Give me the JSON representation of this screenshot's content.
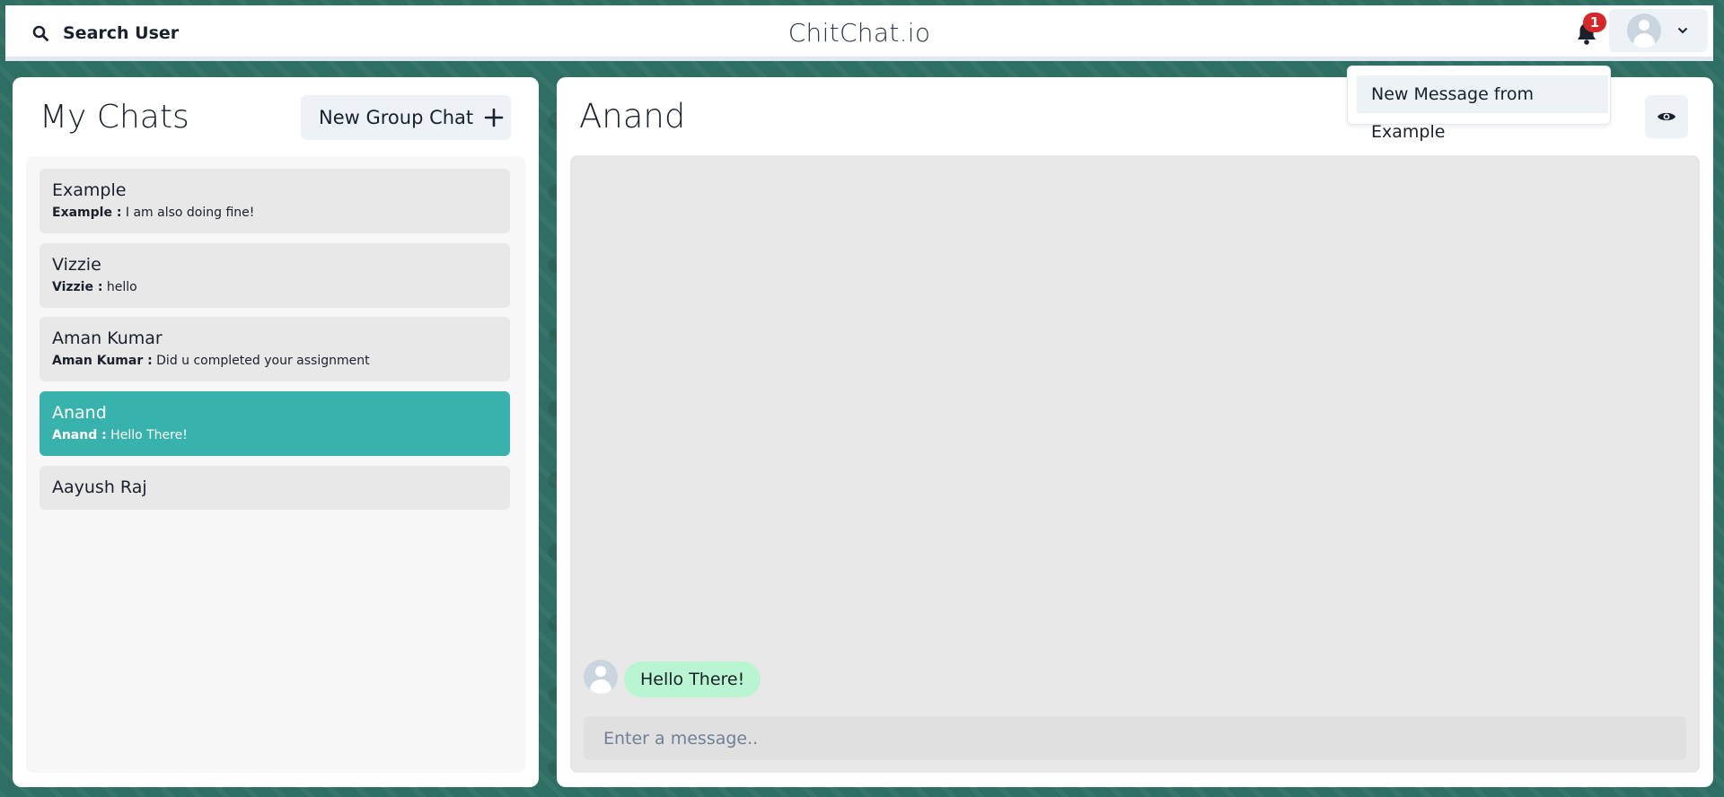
{
  "header": {
    "search_label": "Search User",
    "brand": "ChitChat.io",
    "notification_count": "1"
  },
  "notifications": {
    "items": [
      "New Message from Example"
    ]
  },
  "sidebar": {
    "title": "My Chats",
    "new_group_label": "New Group Chat",
    "chats": [
      {
        "name": "Example",
        "sender": "Example :",
        "message": "I am also doing fine!",
        "active": false
      },
      {
        "name": "Vizzie",
        "sender": "Vizzie :",
        "message": "hello",
        "active": false
      },
      {
        "name": "Aman Kumar",
        "sender": "Aman Kumar :",
        "message": "Did u completed your assignment",
        "active": false
      },
      {
        "name": "Anand",
        "sender": "Anand :",
        "message": "Hello There!",
        "active": true
      },
      {
        "name": "Aayush Raj",
        "sender": "",
        "message": "",
        "active": false
      }
    ]
  },
  "chat": {
    "title": "Anand",
    "messages": [
      {
        "text": "Hello There!"
      }
    ],
    "input_placeholder": "Enter a message.."
  },
  "colors": {
    "active_chat": "#38b2ac",
    "message_bubble": "#b9f5d0",
    "badge": "#d62828",
    "background_pattern": "#2f6f63"
  },
  "icons": {
    "search": "search-icon",
    "bell": "bell-icon",
    "avatar": "avatar-icon",
    "chevron": "chevron-down-icon",
    "plus": "plus-icon",
    "eye": "eye-icon"
  }
}
